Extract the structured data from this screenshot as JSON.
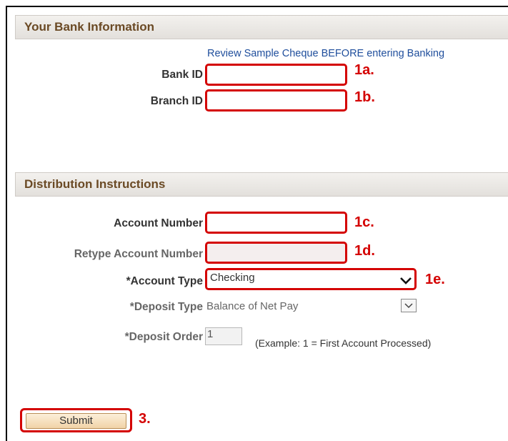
{
  "bank_section": {
    "title": "Your Bank Information",
    "sample_link": "Review Sample Cheque BEFORE entering Banking",
    "bank_id_label": "Bank ID",
    "bank_id_value": "",
    "branch_id_label": "Branch ID",
    "branch_id_value": ""
  },
  "distribution_section": {
    "title": "Distribution Instructions",
    "account_number_label": "Account Number",
    "account_number_value": "",
    "retype_label": "Retype Account Number",
    "retype_value": "",
    "account_type_label": "*Account Type",
    "account_type_value": "Checking",
    "deposit_type_label": "*Deposit Type",
    "deposit_type_value": "Balance of Net Pay",
    "deposit_order_label": "*Deposit Order",
    "deposit_order_value": "1",
    "deposit_order_example": "(Example: 1 = First Account Processed)"
  },
  "submit_label": "Submit",
  "annotations": {
    "bank_id": "1a.",
    "branch_id": "1b.",
    "account_number": "1c.",
    "retype": "1d.",
    "account_type": "1e.",
    "submit": "3."
  },
  "colors": {
    "highlight": "#d40000",
    "header_text": "#6b4a25",
    "link": "#1f4e9c"
  }
}
